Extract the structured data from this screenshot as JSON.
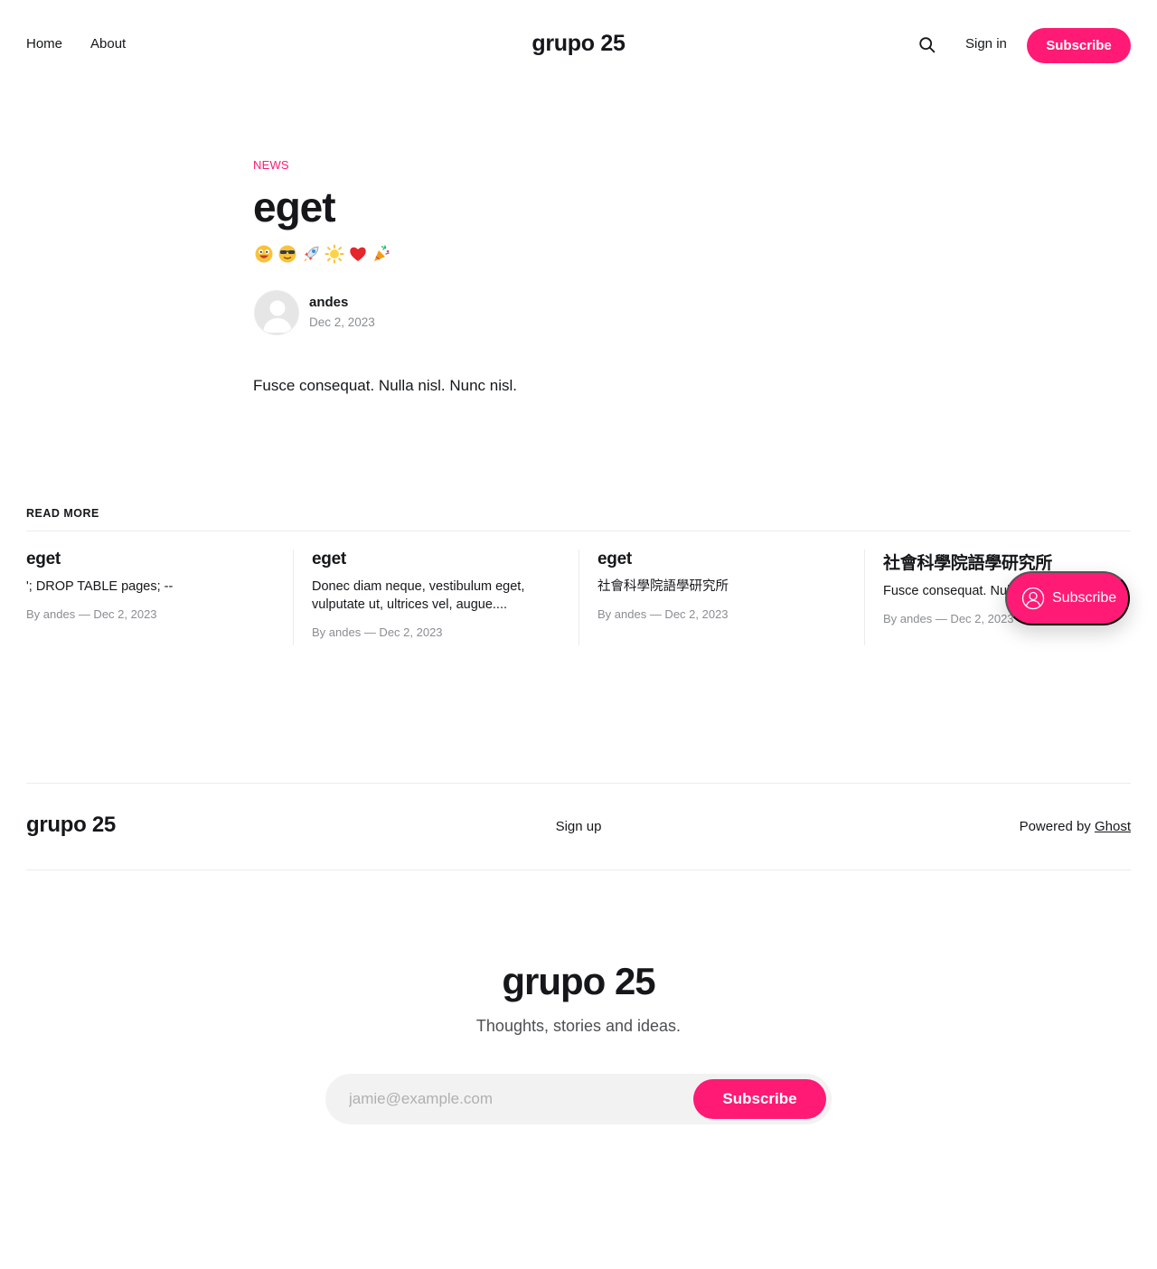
{
  "header": {
    "nav": [
      {
        "label": "Home"
      },
      {
        "label": "About"
      }
    ],
    "logo": "grupo 25",
    "search_icon": "search-icon",
    "sign_in": "Sign in",
    "subscribe": "Subscribe"
  },
  "post": {
    "tag": "NEWS",
    "title": "eget",
    "excerpt_emojis": [
      "grinning-face-icon",
      "sunglasses-face-icon",
      "rocket-icon",
      "sun-icon",
      "heart-icon",
      "party-popper-icon"
    ],
    "author": "andes",
    "date": "Dec 2, 2023",
    "body": "Fusce consequat. Nulla nisl. Nunc nisl."
  },
  "read_more": {
    "title": "READ MORE",
    "cards": [
      {
        "title": "eget",
        "excerpt": "'; DROP TABLE pages; --",
        "meta": "By andes — Dec 2, 2023"
      },
      {
        "title": "eget",
        "excerpt": "Donec diam neque, vestibulum eget, vulputate ut, ultrices vel, augue....",
        "meta": "By andes — Dec 2, 2023"
      },
      {
        "title": "eget",
        "excerpt": "社會科學院語學研究所",
        "meta": "By andes — Dec 2, 2023"
      },
      {
        "title": "社會科學院語學研究所",
        "excerpt": "Fusce consequat. Nulla nisl. Nunc nisl.",
        "meta": "By andes — Dec 2, 2023"
      }
    ]
  },
  "portal": {
    "label": "Subscribe",
    "icon": "user-circle-icon"
  },
  "footer": {
    "logo": "grupo 25",
    "signup": "Sign up",
    "powered_prefix": "Powered by ",
    "powered_link": "Ghost"
  },
  "cta": {
    "title": "grupo 25",
    "description": "Thoughts, stories and ideas.",
    "email_placeholder": "jamie@example.com",
    "button": "Subscribe"
  },
  "colors": {
    "accent": "#ff1a75",
    "text": "#15171a",
    "muted": "#8a8d91"
  }
}
